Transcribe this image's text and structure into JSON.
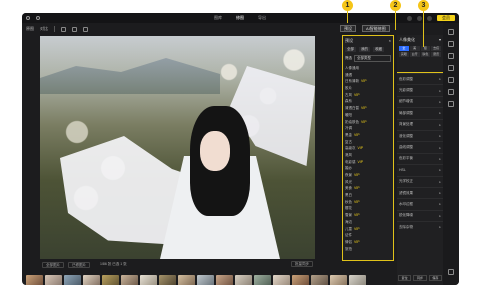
{
  "topbar": {
    "tabs": [
      {
        "label": "图库"
      },
      {
        "label": "修图"
      },
      {
        "label": "导出"
      }
    ],
    "upgrade_label": "会员"
  },
  "toolbar2": {
    "a": "原图",
    "b": "对比"
  },
  "status": {
    "b1": "全部图片",
    "b2": "已修图片",
    "mid": "1/86 张  已选 1 张",
    "right": "批量同步"
  },
  "panel_top": {
    "preset": "预设",
    "ai": "AI智能修图"
  },
  "left_panel": {
    "title": "预设",
    "tabs": [
      "全部",
      "我的",
      "收藏"
    ],
    "filter_label": "筛选",
    "filter_value": "全部类型",
    "rows": [
      {
        "label": "人像通用",
        "tag": ""
      },
      {
        "label": "通透",
        "tag": ""
      },
      {
        "label": "日系清新",
        "tag": "VIP"
      },
      {
        "label": "胶片",
        "tag": ""
      },
      {
        "label": "古风",
        "tag": "VIP"
      },
      {
        "label": "森系",
        "tag": ""
      },
      {
        "label": "清透白皙",
        "tag": "VIP"
      },
      {
        "label": "暖阳",
        "tag": ""
      },
      {
        "label": "奶油肤色",
        "tag": "VIP"
      },
      {
        "label": "冷调",
        "tag": ""
      },
      {
        "label": "黑金",
        "tag": "VIP"
      },
      {
        "label": "复古",
        "tag": ""
      },
      {
        "label": "高级灰",
        "tag": "VIP"
      },
      {
        "label": "港风",
        "tag": ""
      },
      {
        "label": "电影感",
        "tag": "VIP"
      },
      {
        "label": "婚纱",
        "tag": ""
      },
      {
        "label": "夜景",
        "tag": "VIP"
      },
      {
        "label": "风光",
        "tag": ""
      },
      {
        "label": "美食",
        "tag": "VIP"
      },
      {
        "label": "黑白",
        "tag": ""
      },
      {
        "label": "秋色",
        "tag": "VIP"
      },
      {
        "label": "樱花",
        "tag": ""
      },
      {
        "label": "雪景",
        "tag": "VIP"
      },
      {
        "label": "海边",
        "tag": ""
      },
      {
        "label": "儿童",
        "tag": "VIP"
      },
      {
        "label": "证件",
        "tag": ""
      },
      {
        "label": "情侣",
        "tag": "VIP"
      },
      {
        "label": "旅拍",
        "tag": ""
      }
    ]
  },
  "right_panel": {
    "title": "人像美化",
    "chips": [
      "全",
      "美",
      "瘦",
      "去痘",
      "亮眼",
      "白牙",
      "肤色",
      "磨皮"
    ],
    "sections": [
      {
        "label": "色彩调整"
      },
      {
        "label": "光影调整"
      },
      {
        "label": "细节增强"
      },
      {
        "label": "局部调整"
      },
      {
        "label": "背景处理"
      },
      {
        "label": "液化调整"
      },
      {
        "label": "曲线调整"
      },
      {
        "label": "色彩平衡"
      },
      {
        "label": "HSL"
      },
      {
        "label": "光学校正"
      },
      {
        "label": "滤镜效果"
      },
      {
        "label": "水印边框"
      },
      {
        "label": "锐化降噪"
      },
      {
        "label": "去除杂物"
      }
    ],
    "footer": [
      "复位",
      "同步",
      "保存"
    ]
  },
  "markers": [
    "1",
    "2",
    "3"
  ],
  "colors": {
    "accent": "#f5d31a",
    "selected_chip": "#2d6cff",
    "bg": "#1c1c1e"
  }
}
